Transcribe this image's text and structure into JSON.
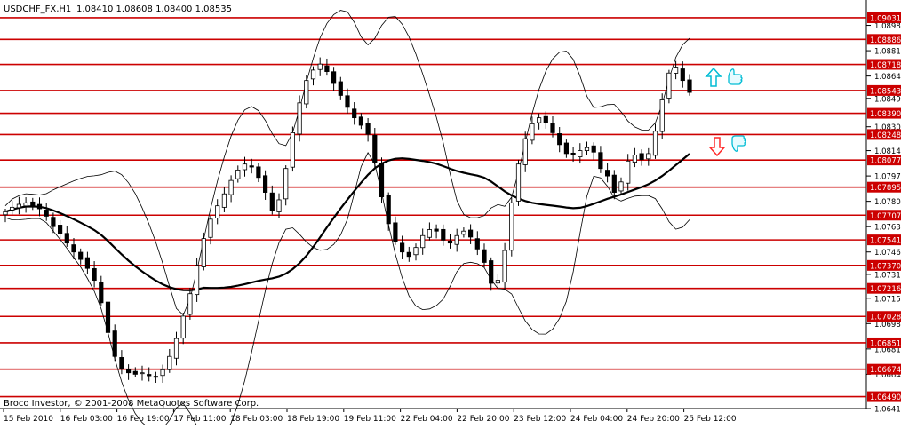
{
  "header": {
    "symbol": "USDCHF_FX,H1",
    "ohlc": "1.08410 1.08608 1.08400 1.08535"
  },
  "footer": {
    "copyright": "Broco Investor, © 2001-2008 MetaQuotes Software Corp."
  },
  "colors": {
    "level_line": "#cc0000",
    "level_tag_bg": "#cc0000",
    "up_arrow": "#00bcd4",
    "down_arrow": "#ff2a2a",
    "thumb": "#00bcd4",
    "candles": "#000000",
    "background": "#ffffff"
  },
  "icons": {
    "up_arrow": "up-arrow-icon",
    "down_arrow": "down-arrow-icon",
    "thumb_up": "thumbs-up-icon",
    "thumb_down": "thumbs-down-icon"
  },
  "chart_data": {
    "type": "candlestick",
    "symbol": "USDCHF_FX",
    "timeframe": "H1",
    "ylim": [
      1.0641,
      1.0915
    ],
    "price_axis_ticks": [
      "1.08980",
      "1.08810",
      "1.08640",
      "1.08490",
      "1.08300",
      "1.08140",
      "1.07970",
      "1.07800",
      "1.07630",
      "1.07460",
      "1.07310",
      "1.07150",
      "1.06980",
      "1.06810",
      "1.06640",
      "1.06410"
    ],
    "level_lines": [
      "1.09031",
      "1.08886",
      "1.08718",
      "1.08543",
      "1.08390",
      "1.08248",
      "1.08077",
      "1.07895",
      "1.07707",
      "1.07541",
      "1.07370",
      "1.07216",
      "1.07028",
      "1.06851",
      "1.06674",
      "1.06490"
    ],
    "time_labels": [
      "15 Feb 2010",
      "16 Feb 03:00",
      "16 Feb 19:00",
      "17 Feb 11:00",
      "18 Feb 03:00",
      "18 Feb 19:00",
      "19 Feb 11:00",
      "22 Feb 04:00",
      "22 Feb 20:00",
      "23 Feb 12:00",
      "24 Feb 04:00",
      "24 Feb 20:00",
      "25 Feb 12:00"
    ],
    "close_path": [
      1.0773,
      1.0776,
      1.0778,
      1.0779,
      1.0777,
      1.0775,
      1.077,
      1.0763,
      1.0758,
      1.0752,
      1.0746,
      1.0741,
      1.0735,
      1.0727,
      1.0712,
      1.0692,
      1.0676,
      1.0668,
      1.0665,
      1.0664,
      1.0665,
      1.0663,
      1.0662,
      1.0667,
      1.0676,
      1.0688,
      1.0703,
      1.0718,
      1.0737,
      1.0755,
      1.0768,
      1.0777,
      1.0785,
      1.0794,
      1.0801,
      1.0805,
      1.0803,
      1.0796,
      1.0786,
      1.0774,
      1.0781,
      1.0802,
      1.0826,
      1.0846,
      1.0861,
      1.0868,
      1.0872,
      1.0867,
      1.0859,
      1.0851,
      1.0843,
      1.0836,
      1.0831,
      1.0825,
      1.0806,
      1.0783,
      1.0765,
      1.0753,
      1.0746,
      1.0743,
      1.0749,
      1.0757,
      1.0761,
      1.076,
      1.0754,
      1.0752,
      1.0757,
      1.076,
      1.0756,
      1.0748,
      1.0739,
      1.0725,
      1.0727,
      1.0747,
      1.0779,
      1.0805,
      1.0822,
      1.0832,
      1.0836,
      1.0833,
      1.0826,
      1.0818,
      1.0812,
      1.0811,
      1.0814,
      1.0816,
      1.0813,
      1.0802,
      1.0797,
      1.0786,
      1.0793,
      1.0807,
      1.0811,
      1.0808,
      1.0812,
      1.0827,
      1.0848,
      1.0866,
      1.087,
      1.0861,
      1.0853
    ]
  }
}
